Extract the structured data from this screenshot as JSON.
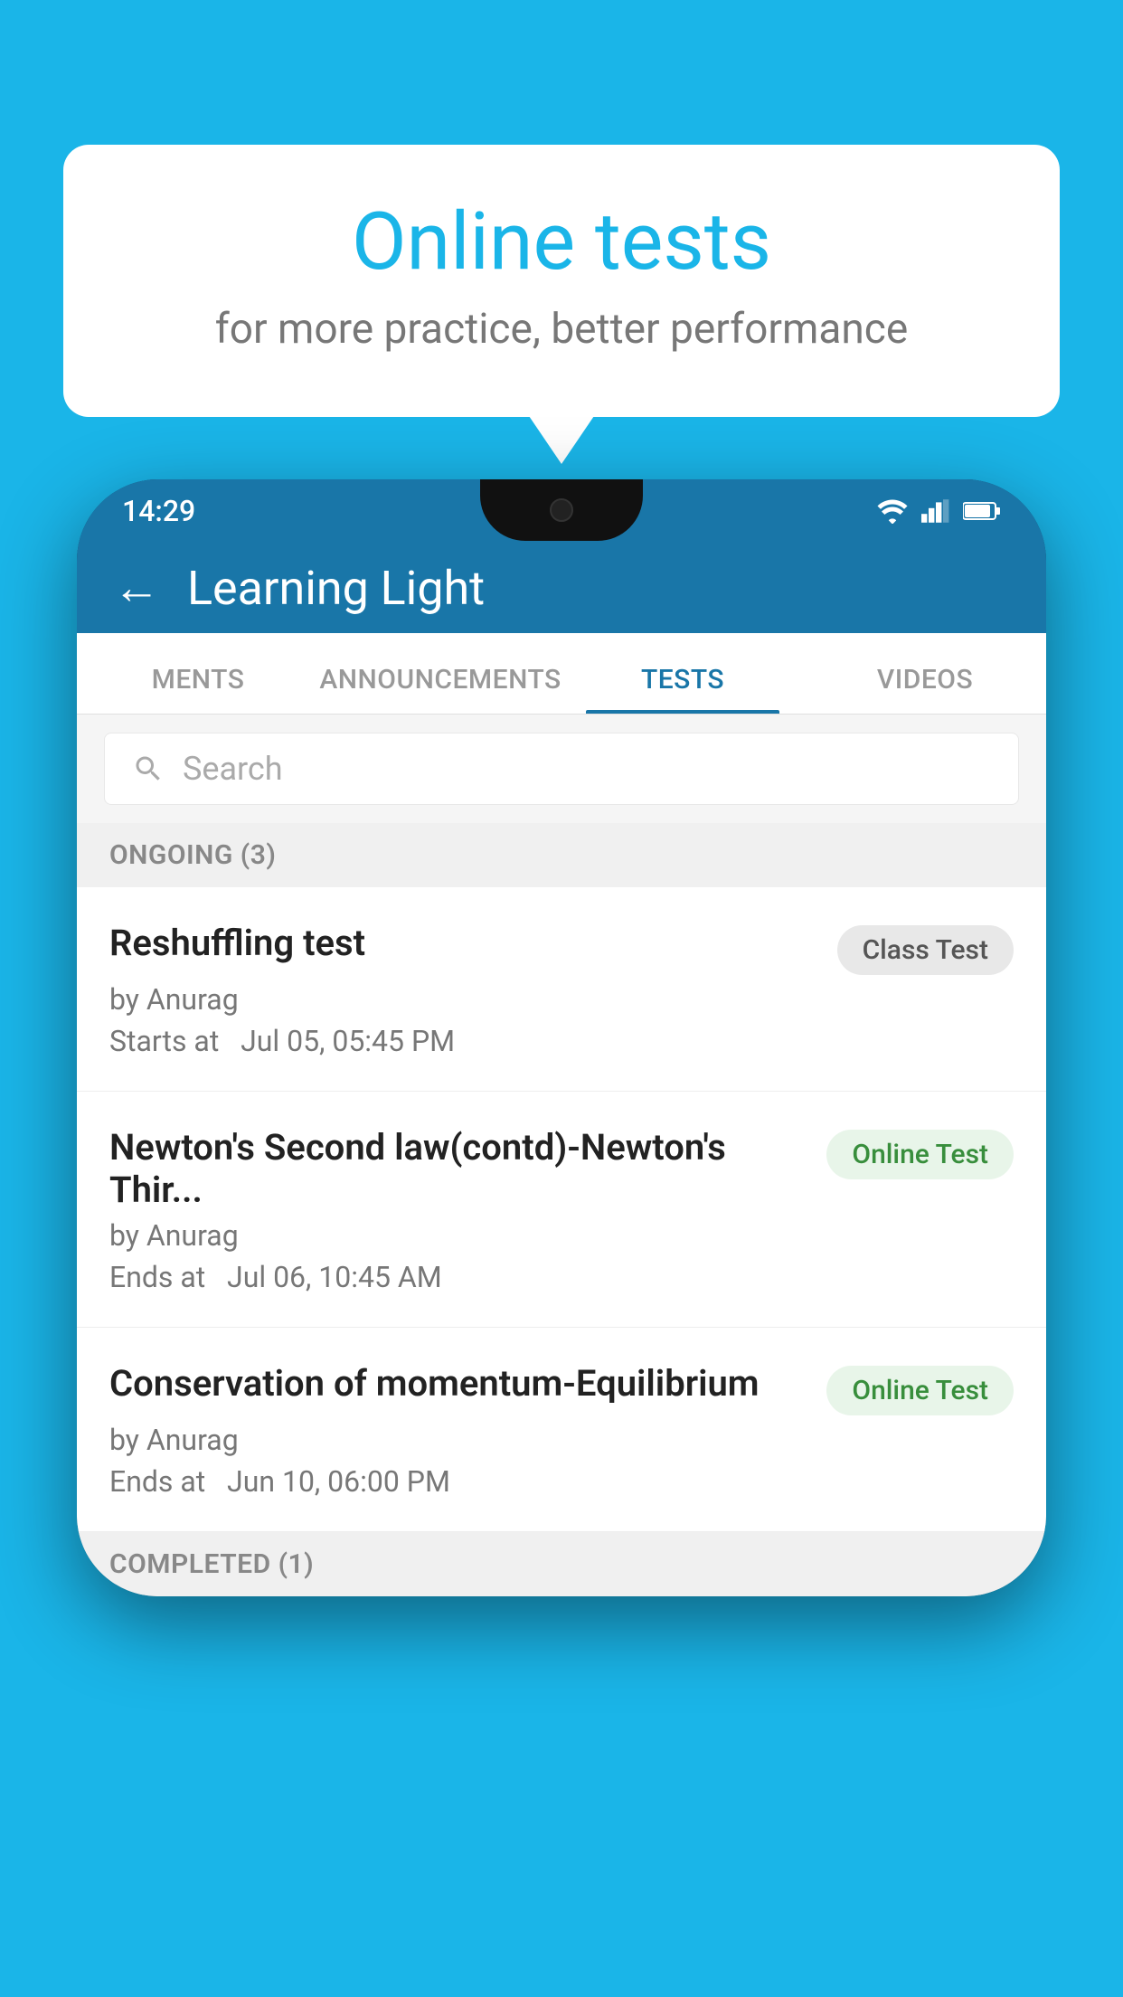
{
  "background_color": "#1ab5e8",
  "bubble": {
    "title": "Online tests",
    "subtitle": "for more practice, better performance"
  },
  "phone": {
    "status_bar": {
      "time": "14:29"
    },
    "app_bar": {
      "title": "Learning Light",
      "back_label": "←"
    },
    "tabs": [
      {
        "label": "MENTS",
        "active": false
      },
      {
        "label": "ANNOUNCEMENTS",
        "active": false
      },
      {
        "label": "TESTS",
        "active": true
      },
      {
        "label": "VIDEOS",
        "active": false
      }
    ],
    "search": {
      "placeholder": "Search"
    },
    "ongoing_section": {
      "label": "ONGOING (3)"
    },
    "tests": [
      {
        "title": "Reshuffling test",
        "badge": "Class Test",
        "badge_type": "class",
        "author": "by Anurag",
        "date_label": "Starts at",
        "date": "Jul 05, 05:45 PM"
      },
      {
        "title": "Newton's Second law(contd)-Newton's Thir...",
        "badge": "Online Test",
        "badge_type": "online",
        "author": "by Anurag",
        "date_label": "Ends at",
        "date": "Jul 06, 10:45 AM"
      },
      {
        "title": "Conservation of momentum-Equilibrium",
        "badge": "Online Test",
        "badge_type": "online",
        "author": "by Anurag",
        "date_label": "Ends at",
        "date": "Jun 10, 06:00 PM"
      }
    ],
    "completed_section": {
      "label": "COMPLETED (1)"
    }
  }
}
